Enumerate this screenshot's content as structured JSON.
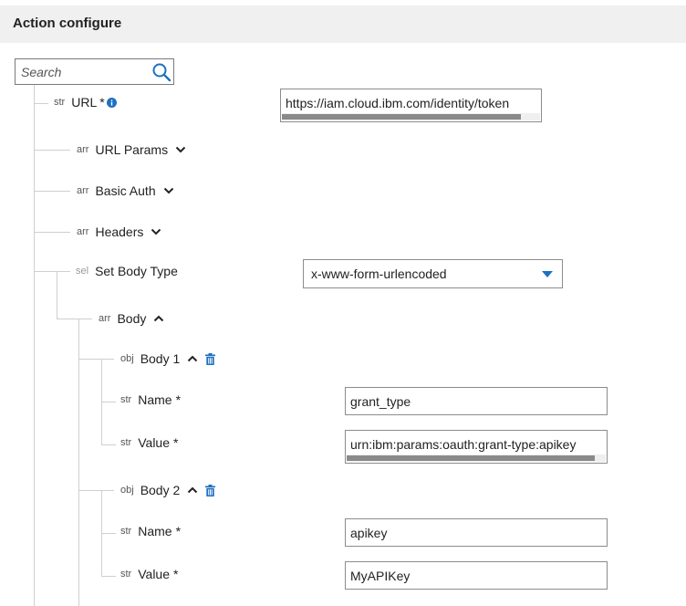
{
  "header": {
    "title": "Action configure"
  },
  "search": {
    "placeholder": "Search",
    "value": "",
    "icon": "search-icon"
  },
  "colors": {
    "accent": "#1f70c1",
    "header_bg": "#f0f0f0",
    "tree_line": "#cfcfcf"
  },
  "tree": {
    "url": {
      "type": "str",
      "label": "URL",
      "required": "*",
      "value": "https://iam.cloud.ibm.com/identity/token"
    },
    "url_params": {
      "type": "arr",
      "label": "URL Params"
    },
    "basic_auth": {
      "type": "arr",
      "label": "Basic Auth"
    },
    "headers": {
      "type": "arr",
      "label": "Headers"
    },
    "body_type": {
      "type": "sel",
      "label": "Set Body Type",
      "selected": "x-www-form-urlencoded"
    },
    "body": {
      "type": "arr",
      "label": "Body",
      "items": [
        {
          "type": "obj",
          "label": "Body 1",
          "name": {
            "type": "str",
            "label": "Name",
            "required": "*",
            "value": "grant_type"
          },
          "value": {
            "type": "str",
            "label": "Value",
            "required": "*",
            "value": "urn:ibm:params:oauth:grant-type:apikey"
          }
        },
        {
          "type": "obj",
          "label": "Body 2",
          "name": {
            "type": "str",
            "label": "Name",
            "required": "*",
            "value": "apikey"
          },
          "value": {
            "type": "str",
            "label": "Value",
            "required": "*",
            "value": "MyAPIKey"
          }
        }
      ]
    }
  }
}
